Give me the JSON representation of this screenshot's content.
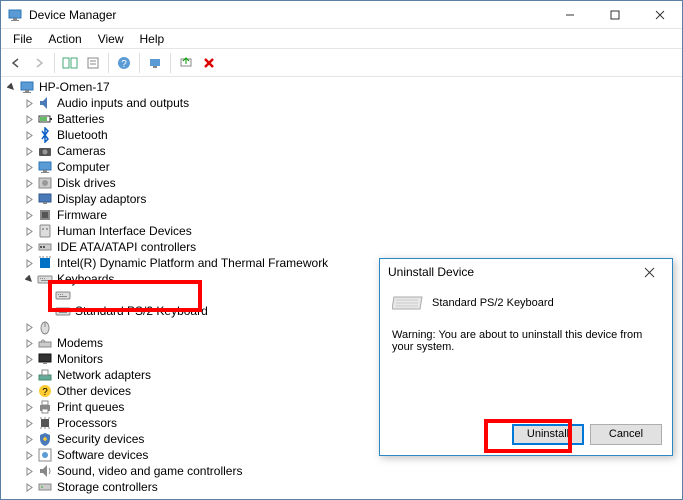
{
  "titlebar": {
    "title": "Device Manager"
  },
  "menubar": {
    "items": [
      "File",
      "Action",
      "View",
      "Help"
    ]
  },
  "tree": {
    "root": "HP-Omen-17",
    "categories": [
      {
        "label": "Audio inputs and outputs",
        "icon": "audio"
      },
      {
        "label": "Batteries",
        "icon": "battery"
      },
      {
        "label": "Bluetooth",
        "icon": "bluetooth"
      },
      {
        "label": "Cameras",
        "icon": "camera"
      },
      {
        "label": "Computer",
        "icon": "computer"
      },
      {
        "label": "Disk drives",
        "icon": "disk"
      },
      {
        "label": "Display adaptors",
        "icon": "display"
      },
      {
        "label": "Firmware",
        "icon": "firmware"
      },
      {
        "label": "Human Interface Devices",
        "icon": "hid"
      },
      {
        "label": "IDE ATA/ATAPI controllers",
        "icon": "ide"
      },
      {
        "label": "Intel(R) Dynamic Platform and Thermal Framework",
        "icon": "intel"
      },
      {
        "label": "Keyboards",
        "icon": "keyboard",
        "expanded": true,
        "children": [
          {
            "label": "",
            "icon": "keyboard",
            "obscured": true
          },
          {
            "label": "Standard PS/2 Keyboard",
            "icon": "keyboard"
          }
        ]
      },
      {
        "label": "",
        "icon": "mouse",
        "obscured": true
      },
      {
        "label": "Modems",
        "icon": "modem"
      },
      {
        "label": "Monitors",
        "icon": "monitor"
      },
      {
        "label": "Network adapters",
        "icon": "network"
      },
      {
        "label": "Other devices",
        "icon": "other"
      },
      {
        "label": "Print queues",
        "icon": "print"
      },
      {
        "label": "Processors",
        "icon": "processor"
      },
      {
        "label": "Security devices",
        "icon": "security"
      },
      {
        "label": "Software devices",
        "icon": "software"
      },
      {
        "label": "Sound, video and game controllers",
        "icon": "sound"
      },
      {
        "label": "Storage controllers",
        "icon": "storage"
      }
    ]
  },
  "dialog": {
    "title": "Uninstall Device",
    "device": "Standard PS/2 Keyboard",
    "warning": "Warning: You are about to uninstall this device from your system.",
    "uninstall": "Uninstall",
    "cancel": "Cancel"
  }
}
